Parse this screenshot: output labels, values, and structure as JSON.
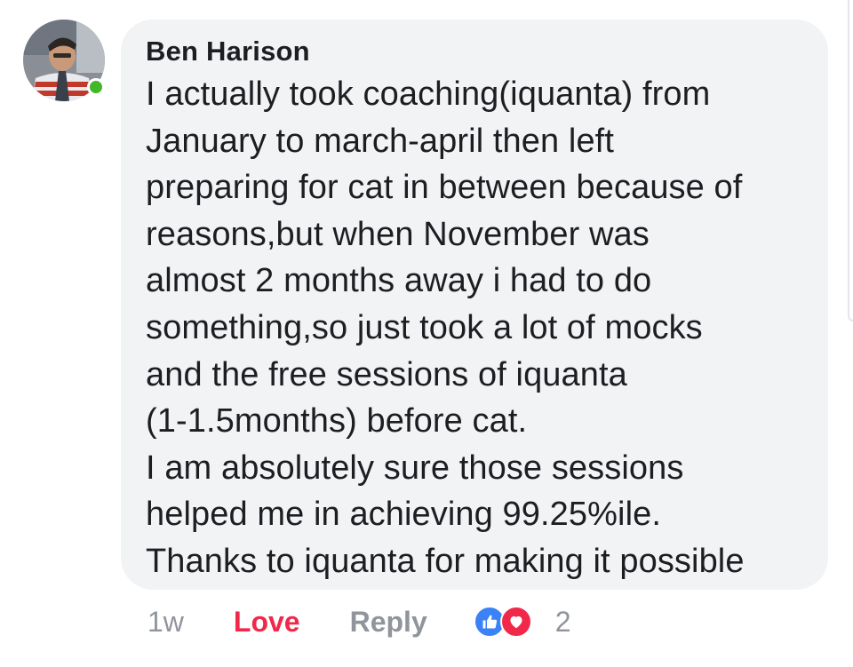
{
  "comment": {
    "author": "Ben Harison",
    "body_lines": [
      "I actually took coaching(iquanta) from",
      "January to march-april then left",
      "preparing for cat in between because of",
      "reasons,but when November was",
      "almost 2 months away i had to do",
      "something,so just took a lot of mocks",
      "and the free sessions of iquanta",
      "(1-1.5months) before cat.",
      "I am absolutely sure those sessions",
      "helped me in achieving 99.25%ile.",
      "Thanks to iquanta for making it possible"
    ],
    "online_status": "online"
  },
  "actions": {
    "time": "1w",
    "love_label": "Love",
    "reply_label": "Reply",
    "reaction_count": "2",
    "reaction_icons": [
      "like-icon",
      "heart-icon"
    ]
  },
  "colors": {
    "bubble_bg": "#f2f3f5",
    "text": "#1c1e21",
    "muted": "#90949c",
    "love": "#f0284a",
    "like_blue": "#3b82f6",
    "online_green": "#42b72a"
  }
}
